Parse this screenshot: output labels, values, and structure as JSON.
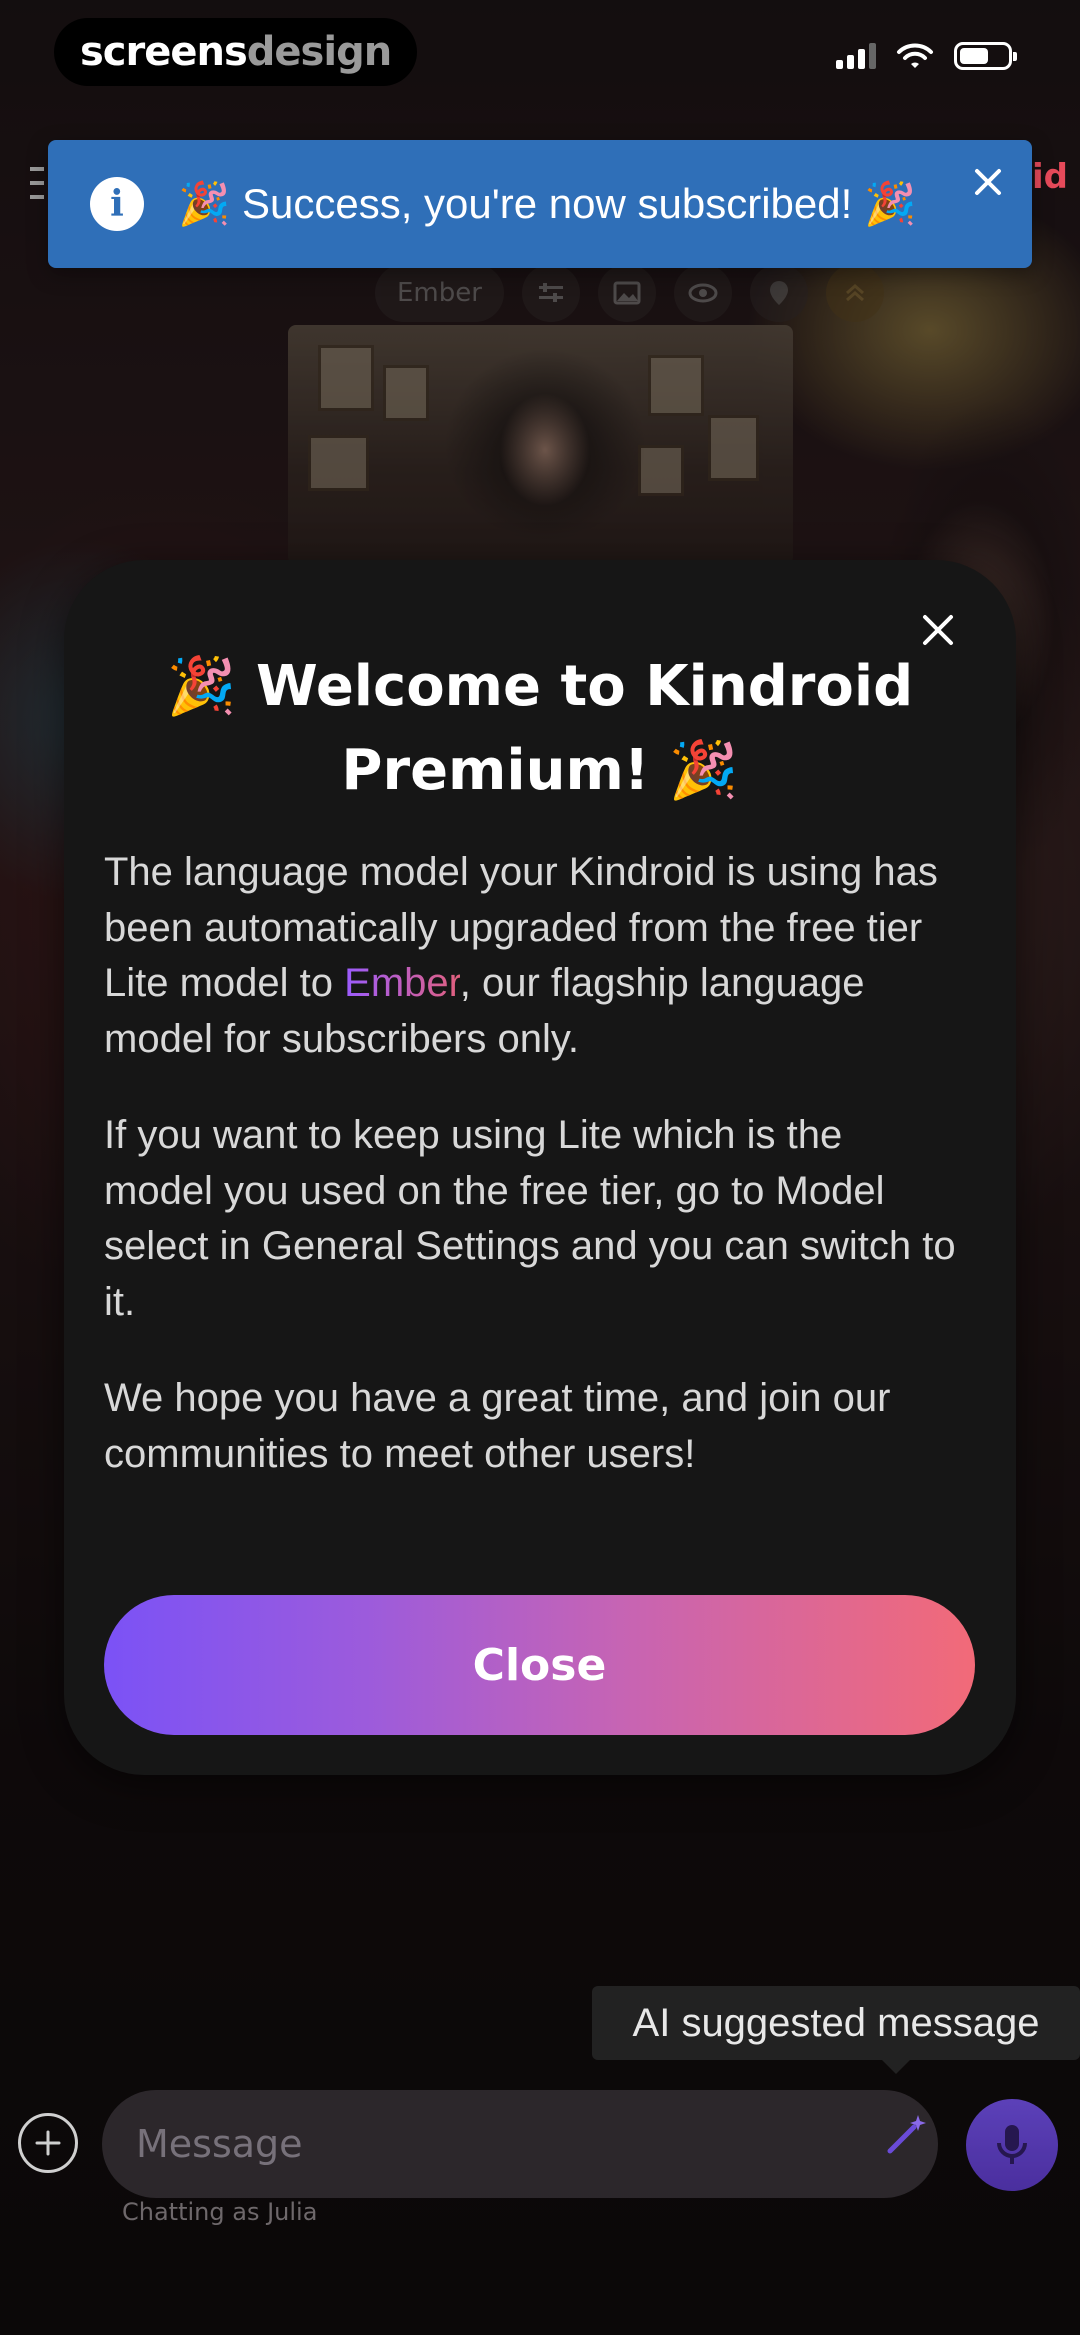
{
  "status_bar": {
    "brand_part1": "screens",
    "brand_part2": "design"
  },
  "toast": {
    "message": "🎉 Success, you're now subscribed! 🎉",
    "info_icon": "info-icon",
    "close_icon": "close-icon"
  },
  "background": {
    "partial_name": "id",
    "toolbar": {
      "model_pill": "Ember"
    }
  },
  "modal": {
    "title_line1": "🎉 Welcome to Kindroid",
    "title_line2": "Premium! 🎉",
    "paragraph1_before": "The language model your Kindroid is using has been automatically upgraded from the free tier Lite model to ",
    "paragraph1_highlight": "Ember",
    "paragraph1_after": ", our flagship language model for subscribers only.",
    "paragraph2": "If you want to keep using Lite which is the model you used on the free tier, go to Model select in General Settings and you can switch to it.",
    "paragraph3": "We hope you have a great time, and join our communities to meet other users!",
    "close_button_label": "Close",
    "highlight_gradient": [
      "#9b5cff",
      "#e2607d"
    ],
    "button_gradient": [
      "#7b52f6",
      "#f26a78"
    ]
  },
  "composer": {
    "tooltip": "AI suggested message",
    "placeholder": "Message",
    "chatting_as": "Chatting as Julia",
    "accent_color": "#6a4bd8"
  },
  "colors": {
    "toast_bg": "#2f6fb8",
    "modal_bg": "#161616"
  }
}
